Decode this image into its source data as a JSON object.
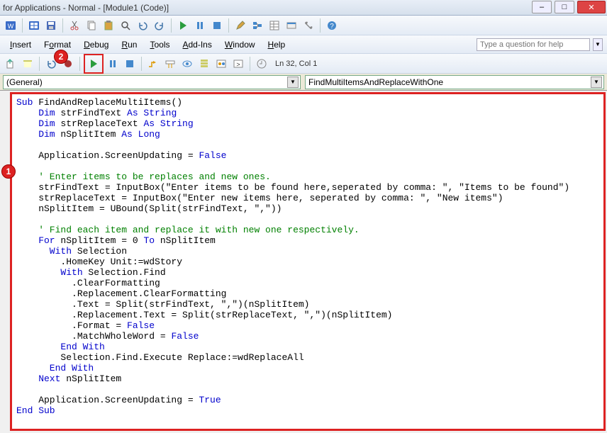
{
  "window": {
    "title": "for Applications - Normal - [Module1 (Code)]"
  },
  "menus": {
    "insert": "Insert",
    "format": "Format",
    "debug": "Debug",
    "run": "Run",
    "tools": "Tools",
    "addins": "Add-Ins",
    "window": "Window",
    "help": "Help"
  },
  "help_placeholder": "Type a question for help",
  "status": {
    "lncol": "Ln 32, Col 1"
  },
  "dropdowns": {
    "left": "(General)",
    "right": "FindMultiItemsAndReplaceWithOne"
  },
  "badges": {
    "one": "1",
    "two": "2"
  },
  "icons": {
    "word": "word-icon",
    "excel": "excel-icon",
    "save": "save-icon",
    "cut": "cut-icon",
    "copy": "copy-icon",
    "paste": "paste-icon",
    "find": "find-icon",
    "undo": "undo-icon",
    "redo": "redo-icon",
    "run": "run-icon",
    "pause": "pause-icon",
    "stop": "stop-icon",
    "design": "design-icon",
    "project": "project-icon",
    "properties": "properties-icon",
    "object": "object-icon",
    "toolbox": "toolbox-icon",
    "helpq": "help-icon",
    "export": "export-icon",
    "import": "import-icon",
    "break": "breakpoint-icon",
    "step": "step-icon",
    "watch": "watch-icon",
    "quick": "quickwatch-icon",
    "call": "callstack-icon",
    "local": "locals-icon",
    "imm": "immediate-icon"
  },
  "code": {
    "l1a": "Sub",
    "l1b": " FindAndReplaceMultiItems()",
    "l2a": "    Dim",
    "l2b": " strFindText ",
    "l2c": "As String",
    "l3a": "    Dim",
    "l3b": " strReplaceText ",
    "l3c": "As String",
    "l4a": "    Dim",
    "l4b": " nSplitItem ",
    "l4c": "As Long",
    "l5": " ",
    "l6a": "    Application.ScreenUpdating = ",
    "l6b": "False",
    "l7": " ",
    "l8": "    ' Enter items to be replaces and new ones.",
    "l9": "    strFindText = InputBox(\"Enter items to be found here,seperated by comma: \", \"Items to be found\")",
    "l10": "    strReplaceText = InputBox(\"Enter new items here, seperated by comma: \", \"New items\")",
    "l11": "    nSplitItem = UBound(Split(strFindText, \",\"))",
    "l12": " ",
    "l13": "    ' Find each item and replace it with new one respectively.",
    "l14a": "    For",
    "l14b": " nSplitItem = 0 ",
    "l14c": "To",
    "l14d": " nSplitItem",
    "l15a": "      With",
    "l15b": " Selection",
    "l16": "        .HomeKey Unit:=wdStory",
    "l17a": "        With",
    "l17b": " Selection.Find",
    "l18": "          .ClearFormatting",
    "l19": "          .Replacement.ClearFormatting",
    "l20": "          .Text = Split(strFindText, \",\")(nSplitItem)",
    "l21": "          .Replacement.Text = Split(strReplaceText, \",\")(nSplitItem)",
    "l22a": "          .Format = ",
    "l22b": "False",
    "l23a": "          .MatchWholeWord = ",
    "l23b": "False",
    "l24": "        End With",
    "l25": "        Selection.Find.Execute Replace:=wdReplaceAll",
    "l26": "      End With",
    "l27a": "    Next",
    "l27b": " nSplitItem",
    "l28": " ",
    "l29a": "    Application.ScreenUpdating = ",
    "l29b": "True",
    "l30": "End Sub"
  }
}
